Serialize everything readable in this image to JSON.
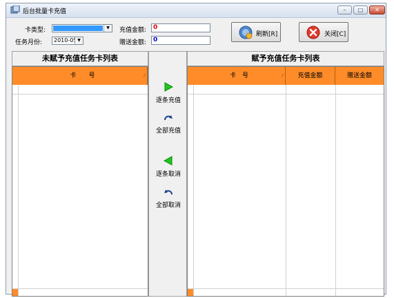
{
  "window": {
    "title": "后台批量卡充值",
    "controls": {
      "minimize": "–",
      "maximize": "□",
      "close": "✕"
    }
  },
  "form": {
    "card_type_label": "卡类型:",
    "card_type_value": "",
    "month_label": "任务月份:",
    "month_value": "2010-05",
    "amount_label": "充值金额:",
    "amount_value": "0",
    "gift_label": "赠送金额:",
    "gift_value": "0"
  },
  "buttons": {
    "refresh": "刷新[R]",
    "close": "关闭[C]"
  },
  "left_panel": {
    "title": "未赋予充值任务卡列表",
    "columns": [
      "卡　　号"
    ]
  },
  "right_panel": {
    "title": "赋予充值任务卡列表",
    "columns": [
      "卡　号",
      "充值金额",
      "赠送金额"
    ]
  },
  "actions": [
    {
      "label": "逐条充值",
      "icon": "arrow-right-icon"
    },
    {
      "label": "全部充值",
      "icon": "redo-icon"
    },
    {
      "label": "逐条取消",
      "icon": "arrow-left-icon"
    },
    {
      "label": "全部取消",
      "icon": "undo-icon"
    }
  ],
  "colors": {
    "header_orange": "#ff8c29",
    "arrow_green": "#1ec81e"
  }
}
